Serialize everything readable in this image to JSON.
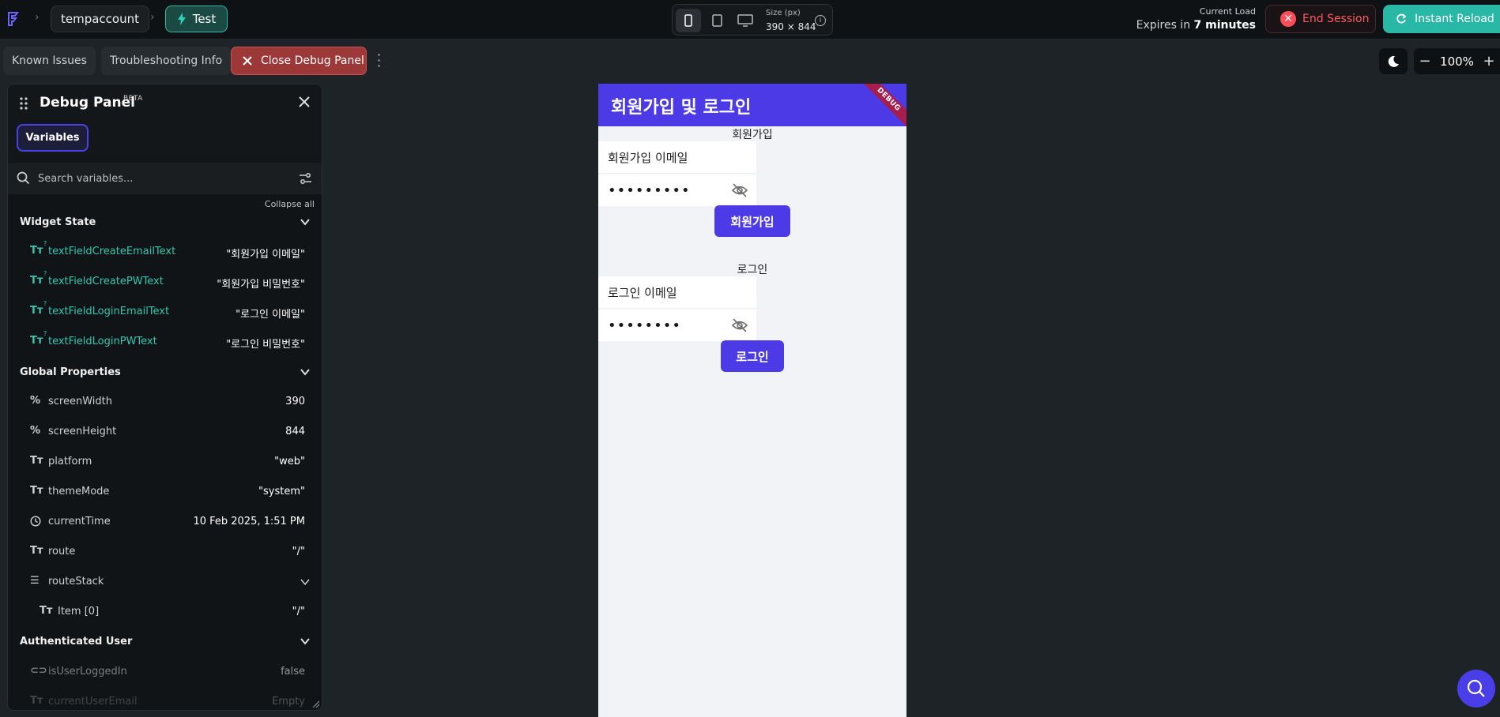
{
  "topbar": {
    "project": "tempaccount",
    "branch": "Test",
    "size_label": "Size (px)",
    "size_value": "390 × 844",
    "load_label": "Current Load",
    "expires_prefix": "Expires in ",
    "expires_value": "7 minutes",
    "end_session": "End Session",
    "instant_reload": "Instant Reload"
  },
  "toolbar": {
    "known_issues": "Known Issues",
    "troubleshooting": "Troubleshooting Info",
    "close_debug": "Close Debug Panel",
    "zoom": "100%"
  },
  "debug_panel": {
    "title": "Debug Panel",
    "beta": "BETA",
    "tab": "Variables",
    "search_placeholder": "Search variables...",
    "collapse_all": "Collapse all",
    "widget_state": {
      "title": "Widget State",
      "items": [
        {
          "name": "textFieldCreateEmailText",
          "value": "\"회원가입 이메일\""
        },
        {
          "name": "textFieldCreatePWText",
          "value": "\"회원가입 비밀번호\""
        },
        {
          "name": "textFieldLoginEmailText",
          "value": "\"로그인 이메일\""
        },
        {
          "name": "textFieldLoginPWText",
          "value": "\"로그인 비밀번호\""
        }
      ]
    },
    "global_properties": {
      "title": "Global Properties",
      "items": [
        {
          "name": "screenWidth",
          "value": "390"
        },
        {
          "name": "screenHeight",
          "value": "844"
        },
        {
          "name": "platform",
          "value": "\"web\""
        },
        {
          "name": "themeMode",
          "value": "\"system\""
        },
        {
          "name": "currentTime",
          "value": "10 Feb 2025, 1:51 PM"
        },
        {
          "name": "route",
          "value": "\"/\""
        },
        {
          "name": "routeStack",
          "value": ""
        },
        {
          "name": "Item [0]",
          "value": "\"/\""
        }
      ]
    },
    "authenticated_user": {
      "title": "Authenticated User",
      "items": [
        {
          "name": "isUserLoggedIn",
          "value": "false"
        },
        {
          "name": "currentUserEmail",
          "value": "Empty"
        }
      ]
    }
  },
  "preview": {
    "app_title": "회원가입 및 로그인",
    "debug_ribbon": "DEBUG",
    "signup_label": "회원가입",
    "signup_email": "회원가입 이메일",
    "signup_password": "•••••••••",
    "signup_button": "회원가입",
    "login_label": "로그인",
    "login_email": "로그인 이메일",
    "login_password": "••••••••",
    "login_button": "로그인"
  },
  "colors": {
    "accent_teal": "#2ab8a6",
    "app_primary": "#4c3ae6",
    "danger": "#ff4d57"
  }
}
